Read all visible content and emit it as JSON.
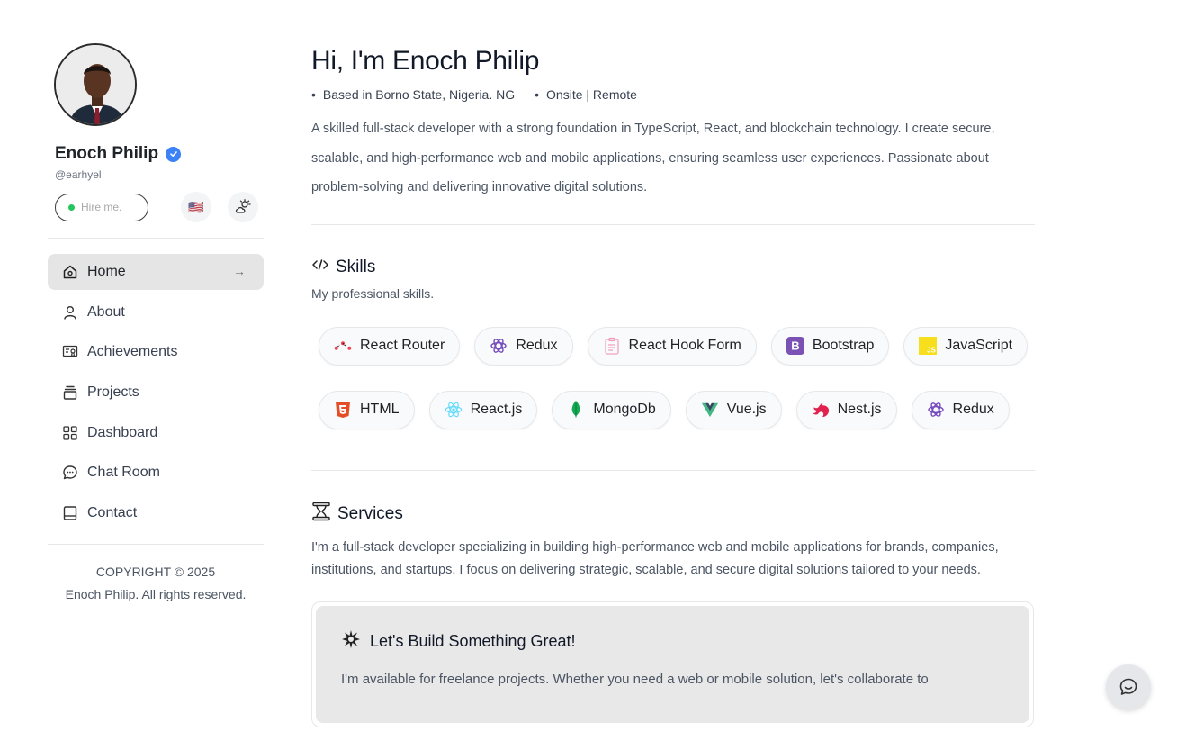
{
  "profile": {
    "name": "Enoch Philip",
    "handle": "@earhyel",
    "hire_label": "Hire me.",
    "flag": "🇺🇸"
  },
  "nav": {
    "items": [
      {
        "label": "Home",
        "icon": "home-icon",
        "active": true
      },
      {
        "label": "About",
        "icon": "user-icon"
      },
      {
        "label": "Achievements",
        "icon": "achievements-icon"
      },
      {
        "label": "Projects",
        "icon": "projects-icon"
      },
      {
        "label": "Dashboard",
        "icon": "dashboard-icon"
      },
      {
        "label": "Chat Room",
        "icon": "chat-icon"
      },
      {
        "label": "Contact",
        "icon": "contact-icon"
      }
    ],
    "active_arrow": "→"
  },
  "footer": {
    "copyright_line1": "COPYRIGHT © 2025",
    "copyright_line2": "Enoch Philip. All rights reserved."
  },
  "hero": {
    "greeting": "Hi, I'm Enoch Philip",
    "location": "Based in Borno State, Nigeria. NG",
    "work_mode": "Onsite | Remote",
    "bio": "A skilled full-stack developer with a strong foundation in TypeScript, React, and blockchain technology. I create secure, scalable, and high-performance web and mobile applications, ensuring seamless user experiences. Passionate about problem-solving and delivering innovative digital solutions."
  },
  "skills": {
    "title": "Skills",
    "subtitle": "My professional skills.",
    "row1": [
      "React Router",
      "Redux",
      "React Hook Form",
      "Bootstrap",
      "JavaScript"
    ],
    "row2": [
      "HTML",
      "React.js",
      "MongoDb",
      "Vue.js",
      "Nest.js",
      "Redux"
    ]
  },
  "services": {
    "title": "Services",
    "text": "I'm a full-stack developer specializing in building high-performance web and mobile applications for brands, companies, institutions, and startups. I focus on delivering strategic, scalable, and secure digital solutions tailored to your needs.",
    "cta_title": "Let's Build Something Great!",
    "cta_text": "I'm available for freelance projects. Whether you need a web or mobile solution, let's collaborate to"
  },
  "colors": {
    "accent": "#3b82f6",
    "active_nav_bg": "#e5e5e5",
    "status_dot": "#22c55e"
  }
}
